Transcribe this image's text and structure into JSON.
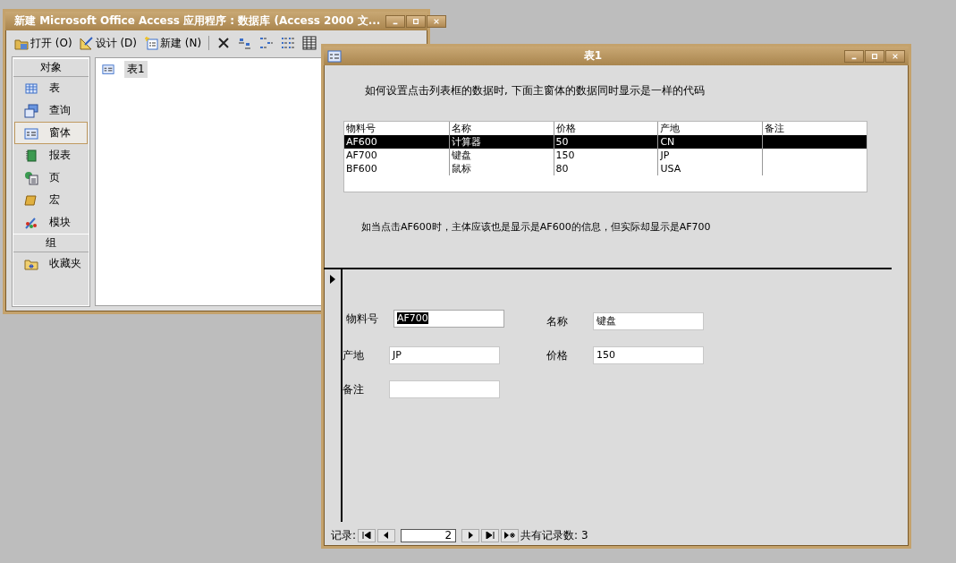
{
  "db_window": {
    "title": "新建 Microsoft Office Access 应用程序 : 数据库 (Access 2000 文...",
    "toolbar": [
      {
        "kind": "open",
        "label": "打开 (O)"
      },
      {
        "kind": "design",
        "label": "设计 (D)"
      },
      {
        "kind": "new",
        "label": "新建 (N)"
      },
      {
        "kind": "delete"
      },
      {
        "kind": "large_icons"
      },
      {
        "kind": "small_icons"
      },
      {
        "kind": "list"
      },
      {
        "kind": "details"
      }
    ],
    "sidebar": {
      "objects_header": "对象",
      "objects": [
        {
          "kind": "table",
          "label": "表",
          "selected": false
        },
        {
          "kind": "query",
          "label": "查询",
          "selected": false
        },
        {
          "kind": "form",
          "label": "窗体",
          "selected": true
        },
        {
          "kind": "report",
          "label": "报表",
          "selected": false
        },
        {
          "kind": "page",
          "label": "页",
          "selected": false
        },
        {
          "kind": "macro",
          "label": "宏",
          "selected": false
        },
        {
          "kind": "module",
          "label": "模块",
          "selected": false
        }
      ],
      "groups_header": "组",
      "groups": [
        {
          "kind": "favorites",
          "label": "收藏夹"
        }
      ]
    },
    "items": [
      {
        "label": "表1",
        "selected": true
      }
    ]
  },
  "form_window": {
    "title": "表1",
    "prompt": "如何设置点击列表框的数据时, 下面主窗体的数据同时显示是一样的代码",
    "listbox": {
      "columns": [
        "物料号",
        "名称",
        "价格",
        "产地",
        "备注"
      ],
      "rows": [
        {
          "cells": [
            "AF600",
            "计算器",
            "50",
            "CN"
          ],
          "selected": true
        },
        {
          "cells": [
            "AF700",
            "键盘",
            "150",
            "JP"
          ],
          "selected": false
        },
        {
          "cells": [
            "BF600",
            "鼠标",
            "80",
            "USA"
          ],
          "selected": false
        }
      ]
    },
    "note": "如当点击AF600时，主体应该也是显示是AF600的信息，但实际却显示是AF700",
    "fields": [
      {
        "label": "物料号",
        "value": "AF700",
        "text_selected": true
      },
      {
        "label": "名称",
        "value": "键盘",
        "text_selected": false
      },
      {
        "label": "产地",
        "value": "JP",
        "text_selected": false
      },
      {
        "label": "价格",
        "value": "150",
        "text_selected": false
      },
      {
        "label": "备注",
        "text_selected": false
      }
    ],
    "navigation": {
      "label": "记录:",
      "current": "2",
      "total": "共有记录数: 3"
    }
  }
}
